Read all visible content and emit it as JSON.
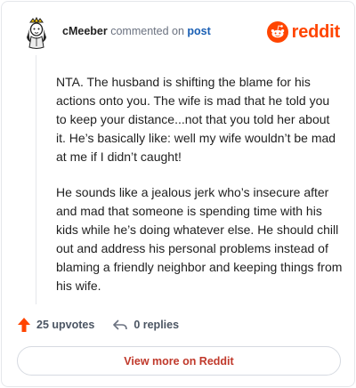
{
  "header": {
    "username": "cMeeber",
    "action_text": "commented on",
    "post_link": "post",
    "brand": "reddit"
  },
  "comment": {
    "paragraphs": [
      "NTA. The husband is shifting the blame for his actions onto you. The wife is mad that he told you to keep your distance...not that you told her about it. He’s basically like: well my wife wouldn’t be mad at me if I didn’t caught!",
      "He sounds like a jealous jerk who’s insecure after and mad that someone is spending time with his kids while he’s doing whatever else. He should chill out and address his personal problems instead of blaming a friendly neighbor and keeping things from his wife."
    ]
  },
  "actions": {
    "upvotes": "25 upvotes",
    "replies": "0 replies"
  },
  "footer": {
    "view_more": "View more on Reddit"
  },
  "colors": {
    "brand": "#ff4500",
    "link": "#1a5fb4",
    "view_more": "#c0392b"
  },
  "icons": [
    "avatar-icon",
    "reddit-logo-icon",
    "upvote-arrow-icon",
    "reply-arrow-icon"
  ]
}
